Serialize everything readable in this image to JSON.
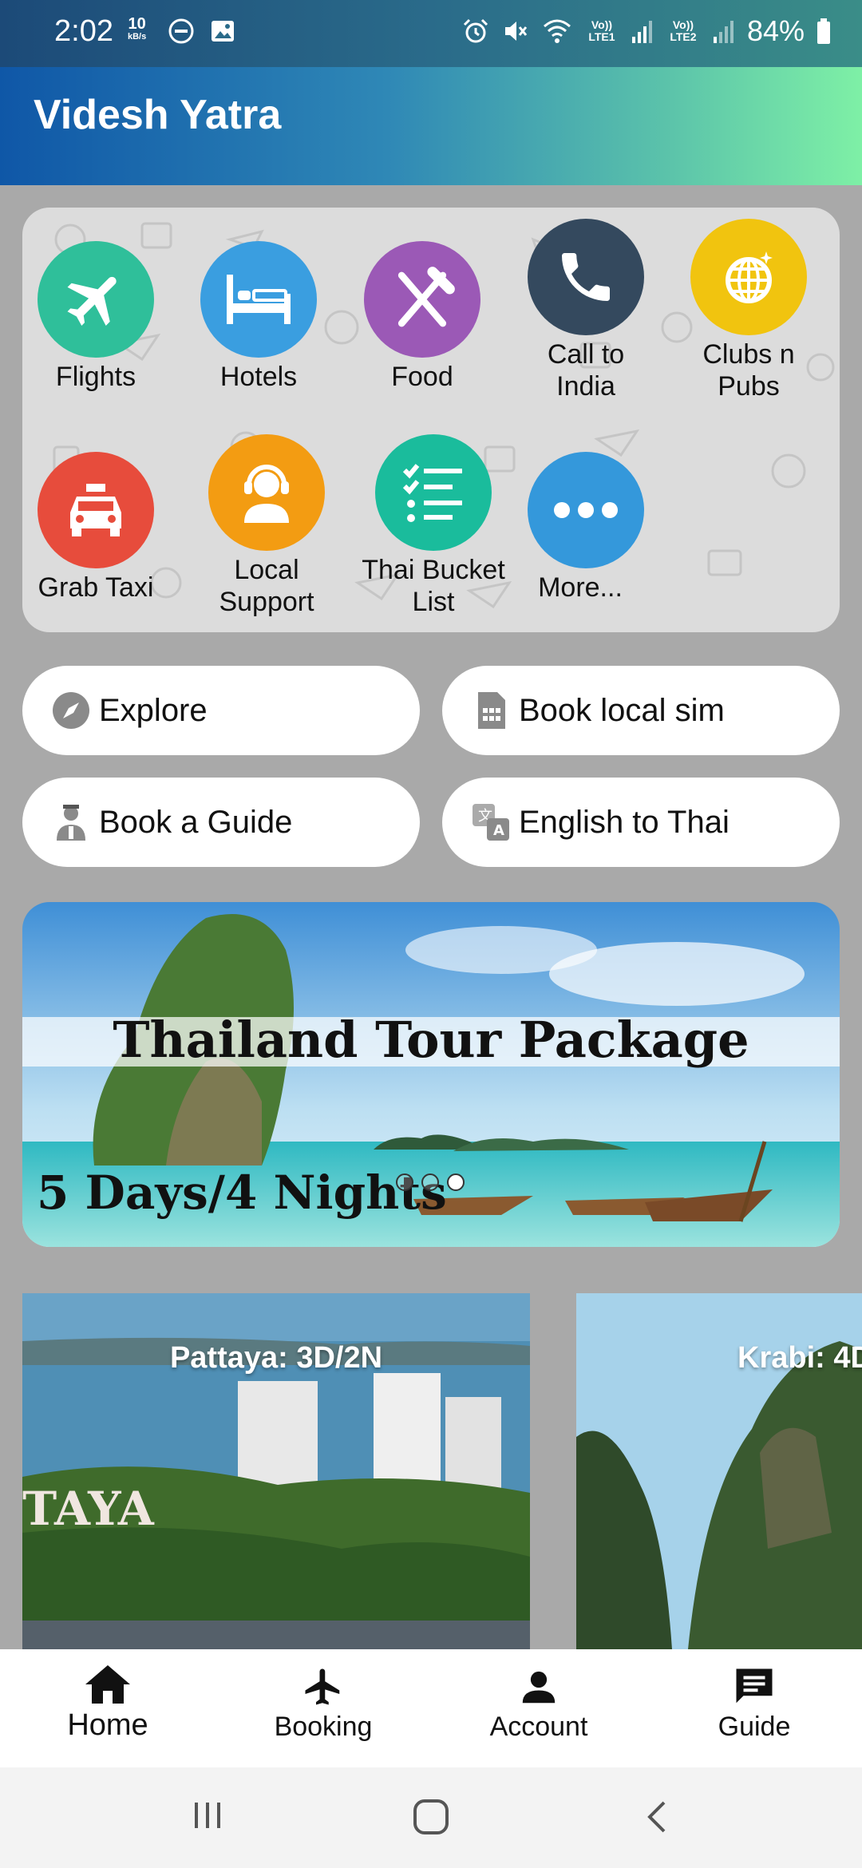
{
  "status_bar": {
    "time": "2:02",
    "speed_value": "10",
    "speed_unit": "kB/s",
    "sim1": "Vo)) LTE1",
    "sim2": "Vo)) LTE2",
    "battery": "84%"
  },
  "app": {
    "title": "Videsh Yatra"
  },
  "services": [
    {
      "label": "Flights",
      "color": "#2fbf9a",
      "icon": "airplane-icon"
    },
    {
      "label": "Hotels",
      "color": "#3a9ee0",
      "icon": "bed-icon"
    },
    {
      "label": "Food",
      "color": "#9b59b6",
      "icon": "utensils-icon"
    },
    {
      "label": "Call to India",
      "color": "#34495e",
      "icon": "phone-icon"
    },
    {
      "label": "Clubs n Pubs",
      "color": "#f1c40f",
      "icon": "disco-ball-icon"
    },
    {
      "label": "Grab Taxi",
      "color": "#e74c3c",
      "icon": "taxi-icon"
    },
    {
      "label": "Local Support",
      "color": "#f39c12",
      "icon": "support-agent-icon"
    },
    {
      "label": "Thai Bucket List",
      "color": "#1abc9c",
      "icon": "checklist-icon"
    },
    {
      "label": "More...",
      "color": "#3498db",
      "icon": "more-dots-icon"
    }
  ],
  "quick_actions": {
    "explore": "Explore",
    "book_sim": "Book local sim",
    "book_guide": "Book a Guide",
    "translate": "English to Thai"
  },
  "banner": {
    "title": "Thailand Tour Package",
    "subtitle": "5 Days/4 Nights"
  },
  "tours": {
    "pattaya": "Pattaya: 3D/2N",
    "krabi": "Krabi: 4D"
  },
  "bottom_nav": {
    "home": "Home",
    "booking": "Booking",
    "account": "Account",
    "guide": "Guide"
  }
}
